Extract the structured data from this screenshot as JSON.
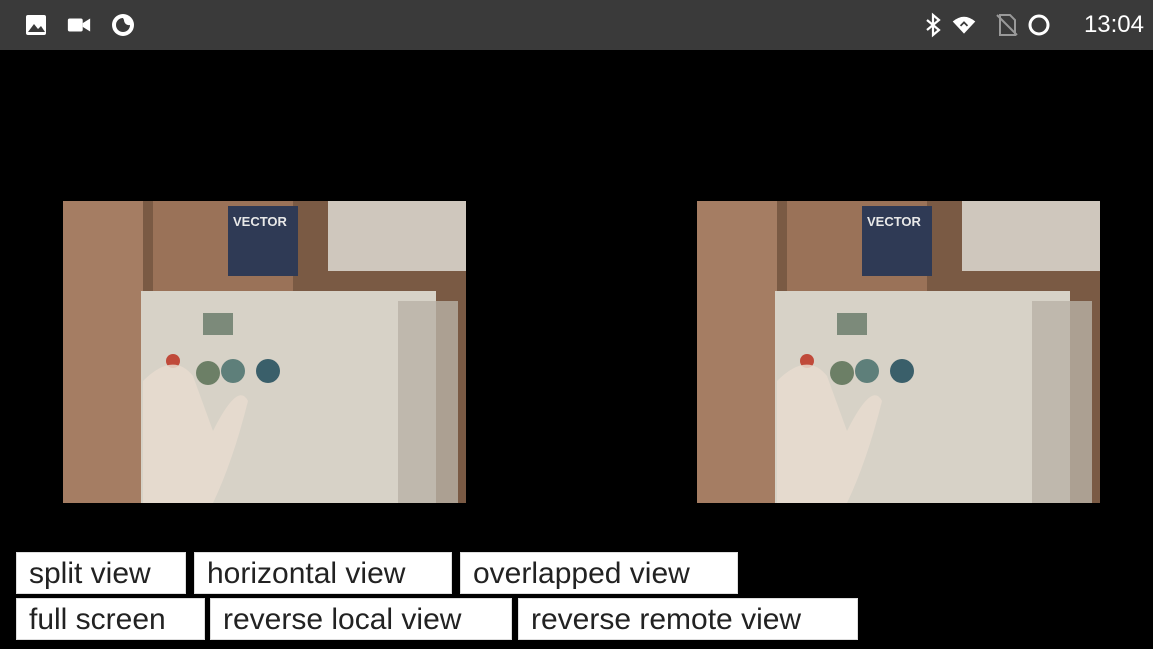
{
  "status_bar": {
    "time": "13:04",
    "left_icons": [
      "image-icon",
      "video-camera-icon",
      "firefox-icon"
    ],
    "right_icons": [
      "bluetooth-icon",
      "wifi-icon",
      "no-sim-icon",
      "sync-icon"
    ]
  },
  "videos": {
    "left": {
      "label": "VECTOR",
      "role": "local-video"
    },
    "right": {
      "label": "VECTOR",
      "role": "remote-video"
    }
  },
  "buttons": {
    "split_view": "split view",
    "horizontal_view": "horizontal view",
    "overlapped_view": "overlapped view",
    "full_screen": "full screen",
    "reverse_local_view": "reverse local view",
    "reverse_remote_view": "reverse remote view"
  },
  "colors": {
    "status_bar_bg": "#3a3a3a",
    "background": "#000000",
    "button_bg": "#ffffff"
  }
}
